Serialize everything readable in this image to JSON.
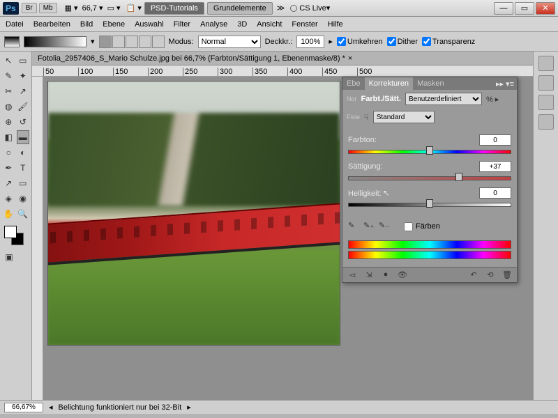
{
  "titlebar": {
    "app": "Ps",
    "chips": [
      "Br",
      "Mb"
    ],
    "zoom": "66,7",
    "btn_tutorials": "PSD-Tutorials",
    "btn_basics": "Grundelemente",
    "cslive": "CS Live"
  },
  "menu": [
    "Datei",
    "Bearbeiten",
    "Bild",
    "Ebene",
    "Auswahl",
    "Filter",
    "Analyse",
    "3D",
    "Ansicht",
    "Fenster",
    "Hilfe"
  ],
  "optbar": {
    "mode_label": "Modus:",
    "mode_value": "Normal",
    "opacity_label": "Deckkr.:",
    "opacity_value": "100%",
    "cb_reverse": "Umkehren",
    "cb_dither": "Dither",
    "cb_transp": "Transparenz"
  },
  "doc": {
    "tab": "Fotolia_2957406_S_Mario Schulze.jpg bei 66,7% (Farbton/Sättigung 1, Ebenenmaske/8) *",
    "ruler_marks": [
      "50",
      "100",
      "150",
      "200",
      "250",
      "300",
      "350",
      "400",
      "450",
      "500"
    ]
  },
  "adjust": {
    "tab_side1": "Ebe",
    "tab_active": "Korrekturen",
    "tab_side2": "Masken",
    "side_label_nor": "Nor",
    "side_label_fix": "Fixie",
    "title": "Farbt./Sätt.",
    "preset": "Benutzerdefiniert",
    "range": "Standard",
    "hue_label": "Farbton:",
    "hue_value": "0",
    "sat_label": "Sättigung:",
    "sat_value": "+37",
    "lig_label": "Helligkeit:",
    "lig_value": "0",
    "colorize": "Färben"
  },
  "status": {
    "zoom": "66,67%",
    "msg": "Belichtung funktioniert nur bei 32-Bit"
  }
}
